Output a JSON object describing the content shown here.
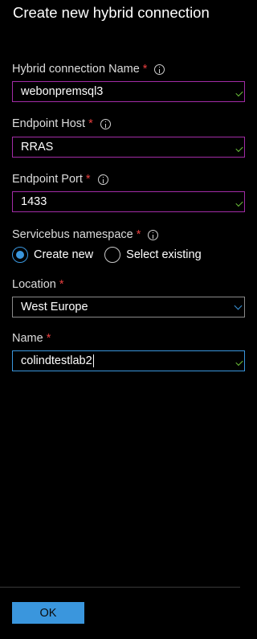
{
  "title": "Create new hybrid connection",
  "fields": {
    "hybrid_name": {
      "label": "Hybrid connection Name",
      "value": "webonpremsql3"
    },
    "endpoint_host": {
      "label": "Endpoint Host",
      "value": "RRAS"
    },
    "endpoint_port": {
      "label": "Endpoint Port",
      "value": "1433"
    },
    "servicebus": {
      "label": "Servicebus namespace",
      "options": [
        "Create new",
        "Select existing"
      ],
      "selected": "Create new"
    },
    "location": {
      "label": "Location",
      "value": "West Europe"
    },
    "name": {
      "label": "Name",
      "value": "colindtestlab2"
    }
  },
  "required_mark": "*",
  "ok_label": "OK",
  "colors": {
    "accent": "#3a96dd",
    "required": "#e83f3f",
    "invalid_border": "#a22ca6",
    "valid_check": "#6cbf3a"
  }
}
